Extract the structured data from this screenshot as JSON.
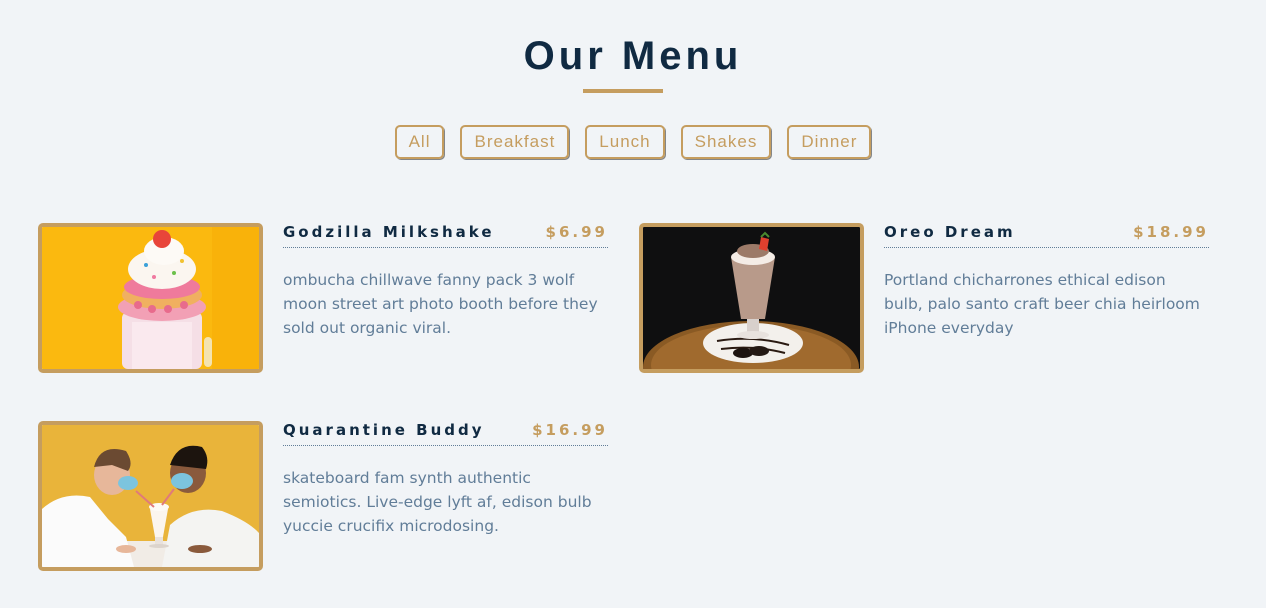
{
  "menu": {
    "title": "Our Menu",
    "filters": [
      "All",
      "Breakfast",
      "Lunch",
      "Shakes",
      "Dinner"
    ],
    "items": [
      {
        "name": "Godzilla Milkshake",
        "price": "$6.99",
        "description": "ombucha chillwave fanny pack 3 wolf moon street art photo booth before they sold out organic viral.",
        "photo_icon": "milkshake-photo"
      },
      {
        "name": "Oreo Dream",
        "price": "$18.99",
        "description": "Portland chicharrones ethical edison bulb, palo santo craft beer chia heirloom iPhone everyday",
        "photo_icon": "oreo-shake-photo"
      },
      {
        "name": "Quarantine Buddy",
        "price": "$16.99",
        "description": "skateboard fam synth authentic semiotics. Live-edge lyft af, edison bulb yuccie crucifix microdosing.",
        "photo_icon": "couple-sharing-shake-photo"
      }
    ]
  },
  "colors": {
    "background": "#f1f4f7",
    "accent": "#c59d5f",
    "heading": "#102a42",
    "text": "#617d98"
  }
}
